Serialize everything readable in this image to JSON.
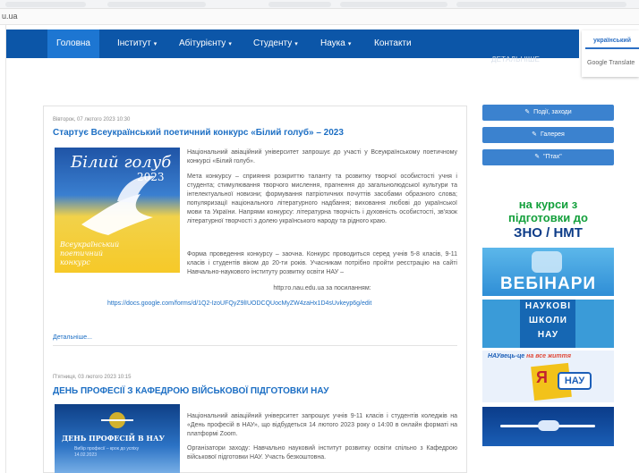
{
  "browser": {
    "url": "u.ua"
  },
  "nav": {
    "items": [
      {
        "label": "Головна",
        "caret": ""
      },
      {
        "label": "Інститут",
        "caret": "▾"
      },
      {
        "label": "Абітурієнту",
        "caret": "▾"
      },
      {
        "label": "Студенту",
        "caret": "▾"
      },
      {
        "label": "Наука",
        "caret": "▾"
      },
      {
        "label": "Контакти",
        "caret": ""
      }
    ],
    "ghost_more": "ДЕТАЛЬНІШЕ"
  },
  "translate": {
    "language": "український",
    "brand": "Google Translate"
  },
  "articles": [
    {
      "date": "Вівторок, 07 лютого 2023 10:30",
      "title": "Стартує Всеукраїнський поетичний конкурс «Білий голуб» – 2023",
      "image": {
        "title": "Білий голуб",
        "year": "2023",
        "caption": "Всеукраїнський поетичний конкурс"
      },
      "paragraphs": [
        "Національний авіаційний університет запрошує до участі у Всеукраїнському поетичному конкурсі «Білий голуб».",
        "Мета конкурсу – сприяння розкриттю таланту та розвитку творчої особистості учня і студента; стимулювання творчого мислення, прагнення до загальнолюдської культури та інтелектуальної новизни; формування патріотичних почуттів засобами образного слова; популяризації національного літературного надбання; виховання любові до української мови та України. Напрями конкурсу: літературна творчість і духовність особистості, зв'язок літературної творчості з долею українського народу та рідного краю.",
        "Форма проведення конкурсу – заочна. Конкурс проводиться серед учнів 5-8 класів, 9-11 класів і студентів віком до 20-ти років. Учасникам потрібно пройти реєстрацію на сайті Навчально-наукового інституту розвитку освіти НАУ –",
        "http:ro.nau.edu.ua за посиланням:"
      ],
      "link": "https://docs.google.com/forms/d/1Q2-IzoUFQyZ9lIUODCQUocMyZW4zaHx1D4sUvkeyp6g/edit",
      "more": "Детальніше..."
    },
    {
      "date": "П'ятниця, 03 лютого 2023 10:15",
      "title": "ДЕНЬ ПРОФЕСІЇ З КАФЕДРОЮ ВІЙСЬКОВОЇ ПІДГОТОВКИ НАУ",
      "image": {
        "title": "ДЕНЬ ПРОФЕСІЙ В НАУ",
        "caption": "Вибір професії – крок до успіху 14.02.2023"
      },
      "paragraphs": [
        "Національний авіаційний університет запрошує учнів 9-11 класів і студентів коледжів на «День професій в НАУ», що відбудеться 14 лютого 2023 року о 14:00 в онлайн форматі на платформі Zoom.",
        "Організатори заходу: Навчально науковий інститут розвитку освіти спільно з Кафедрою військової підготовки НАУ. Участь безкоштовна."
      ]
    }
  ],
  "sidebar": {
    "buttons": [
      {
        "label": "Події, заходи",
        "icon": "link-icon"
      },
      {
        "label": "Галерея",
        "icon": "link-icon"
      },
      {
        "label": "\"Птах\"",
        "icon": "link-icon"
      }
    ],
    "banners": {
      "zno": [
        "на курси з",
        "підготовки до",
        "ЗНО / НМТ"
      ],
      "webinars": "ВЕБІНАРИ",
      "schools": [
        "НАУКОВІ",
        "ШКОЛИ",
        "НАУ"
      ],
      "nau_caption_a": "НАУвець-це ",
      "nau_caption_b": "на все життя",
      "nau_ya": "Я",
      "nau_logo": "НАУ"
    }
  }
}
